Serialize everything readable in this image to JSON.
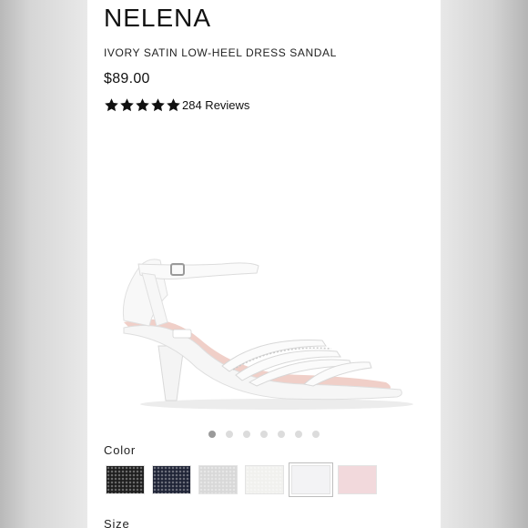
{
  "product": {
    "name": "NELENA",
    "subtitle": "IVORY SATIN LOW-HEEL DRESS SANDAL",
    "price": "$89.00",
    "rating": 5,
    "reviews_label": "284 Reviews"
  },
  "gallery": {
    "image_icon": "ivory-strappy-sandal",
    "dot_count": 7,
    "active_dot": 1
  },
  "color": {
    "label": "Color",
    "swatches": [
      {
        "name": "black-sparkle",
        "color": "#1e1e1e"
      },
      {
        "name": "navy-sparkle",
        "color": "#1f2436"
      },
      {
        "name": "silver-sparkle",
        "color": "#d8d8d8"
      },
      {
        "name": "ivory-glitter",
        "color": "#f1f1ee"
      },
      {
        "name": "ivory-satin",
        "color": "#f3f3f5",
        "selected": true
      },
      {
        "name": "blush",
        "color": "#f2d9dc"
      }
    ]
  },
  "size": {
    "label": "Size"
  }
}
